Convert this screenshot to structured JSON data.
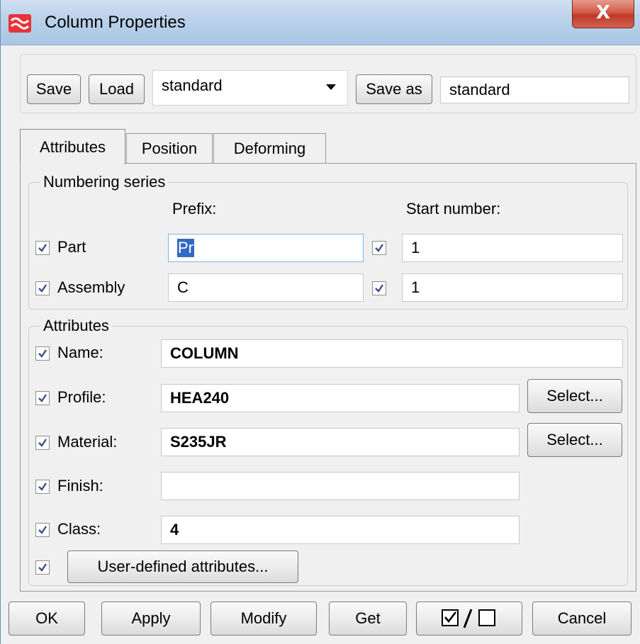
{
  "window": {
    "title": "Column Properties",
    "close_label": "X"
  },
  "toolbar": {
    "save_label": "Save",
    "load_label": "Load",
    "preset_value": "standard",
    "save_as_label": "Save as",
    "save_as_value": "standard"
  },
  "tabs": [
    {
      "label": "Attributes",
      "active": true
    },
    {
      "label": "Position",
      "active": false
    },
    {
      "label": "Deforming",
      "active": false
    }
  ],
  "numbering": {
    "group_label": "Numbering series",
    "prefix_header": "Prefix:",
    "start_header": "Start number:",
    "part_label": "Part",
    "part_prefix": "Pr",
    "part_start": "1",
    "assembly_label": "Assembly",
    "assembly_prefix": "C",
    "assembly_start": "1"
  },
  "attributes": {
    "group_label": "Attributes",
    "name_label": "Name:",
    "name_value": "COLUMN",
    "profile_label": "Profile:",
    "profile_value": "HEA240",
    "material_label": "Material:",
    "material_value": "S235JR",
    "finish_label": "Finish:",
    "finish_value": "",
    "class_label": "Class:",
    "class_value": "4",
    "select_label": "Select...",
    "user_defined_label": "User-defined attributes..."
  },
  "bottom": {
    "ok_label": "OK",
    "apply_label": "Apply",
    "modify_label": "Modify",
    "get_label": "Get",
    "cancel_label": "Cancel"
  },
  "colors": {
    "accent": "#316ac5",
    "title_bar": "#b9d1ea",
    "close_button": "#c0392b"
  }
}
